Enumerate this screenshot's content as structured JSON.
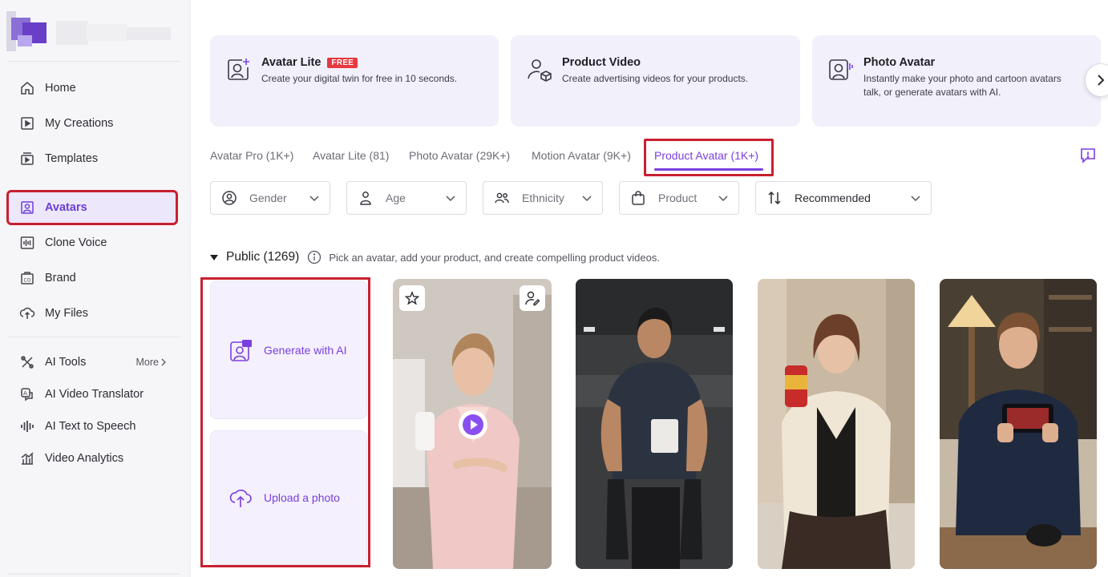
{
  "sidebar": {
    "items": [
      {
        "label": "Home",
        "icon": "home-icon"
      },
      {
        "label": "My Creations",
        "icon": "play-square-icon"
      },
      {
        "label": "Templates",
        "icon": "templates-icon"
      },
      {
        "label": "Avatars",
        "icon": "avatar-icon"
      },
      {
        "label": "Clone Voice",
        "icon": "waveform-icon"
      },
      {
        "label": "Brand",
        "icon": "brand-icon"
      },
      {
        "label": "My Files",
        "icon": "upload-cloud-icon"
      }
    ],
    "tools_label": "AI Tools",
    "more_label": "More",
    "tools": [
      {
        "label": "AI Video Translator",
        "icon": "translate-icon"
      },
      {
        "label": "AI Text to Speech",
        "icon": "audio-bars-icon"
      },
      {
        "label": "Video Analytics",
        "icon": "analytics-icon"
      }
    ]
  },
  "features": [
    {
      "title": "Avatar Lite",
      "badge": "FREE",
      "desc": "Create your digital twin for free in 10 seconds.",
      "icon": "avatar-plus-icon"
    },
    {
      "title": "Product Video",
      "badge": "",
      "desc": "Create advertising videos for your products.",
      "icon": "person-box-icon"
    },
    {
      "title": "Photo Avatar",
      "badge": "",
      "desc": "Instantly make your photo and cartoon avatars talk, or generate avatars with AI.",
      "icon": "photo-avatar-icon"
    }
  ],
  "tabs": [
    {
      "label": "Avatar Pro (1K+)"
    },
    {
      "label": "Avatar Lite (81)"
    },
    {
      "label": "Photo Avatar (29K+)"
    },
    {
      "label": "Motion Avatar (9K+)"
    },
    {
      "label": "Product Avatar (1K+)",
      "active": true
    }
  ],
  "filters": {
    "gender": "Gender",
    "age": "Age",
    "ethnicity": "Ethnicity",
    "product": "Product",
    "sort": "Recommended"
  },
  "section": {
    "title": "Public (1269)",
    "hint": "Pick an avatar, add your product, and create compelling product videos."
  },
  "create": {
    "generate": "Generate with AI",
    "upload": "Upload a photo"
  },
  "colors": {
    "accent": "#7a3fe0",
    "highlight_border": "#c8202f",
    "card_bg": "#f1f0fb"
  }
}
